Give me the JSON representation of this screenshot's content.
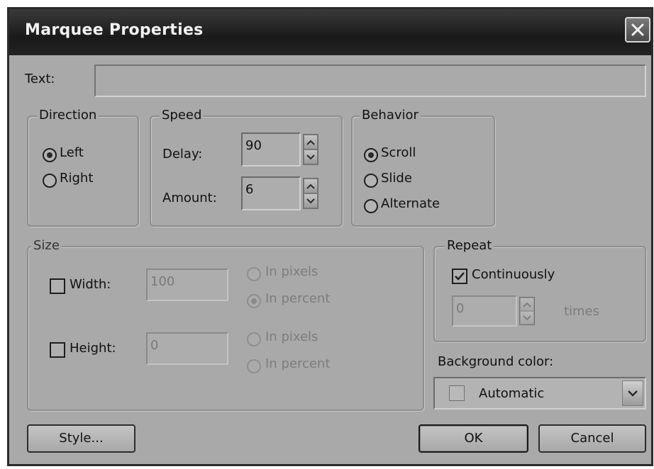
{
  "dialog": {
    "title": "Marquee Properties",
    "text_label": "Text:",
    "text_value": ""
  },
  "direction": {
    "legend": "Direction",
    "options": [
      {
        "label": "Left",
        "checked": true
      },
      {
        "label": "Right",
        "checked": false
      }
    ]
  },
  "speed": {
    "legend": "Speed",
    "delay_label": "Delay:",
    "delay_value": "90",
    "amount_label": "Amount:",
    "amount_value": "6"
  },
  "behavior": {
    "legend": "Behavior",
    "options": [
      {
        "label": "Scroll",
        "checked": true
      },
      {
        "label": "Slide",
        "checked": false
      },
      {
        "label": "Alternate",
        "checked": false
      }
    ]
  },
  "size": {
    "legend": "Size",
    "width_label": "Width:",
    "width_value": "100",
    "width_checked": false,
    "height_label": "Height:",
    "height_value": "0",
    "height_checked": false,
    "in_pixels": "In pixels",
    "in_percent": "In percent"
  },
  "repeat": {
    "legend": "Repeat",
    "continuously_label": "Continuously",
    "continuously_checked": true,
    "times_value": "0",
    "times_label": "times"
  },
  "background": {
    "label": "Background color:",
    "value": "Automatic"
  },
  "buttons": {
    "style": "Style...",
    "ok": "OK",
    "cancel": "Cancel"
  },
  "icons": {
    "close": "close-icon",
    "spin_up": "chevron-up-icon",
    "spin_down": "chevron-down-icon",
    "combo": "chevron-down-icon",
    "check": "checkmark-icon"
  }
}
